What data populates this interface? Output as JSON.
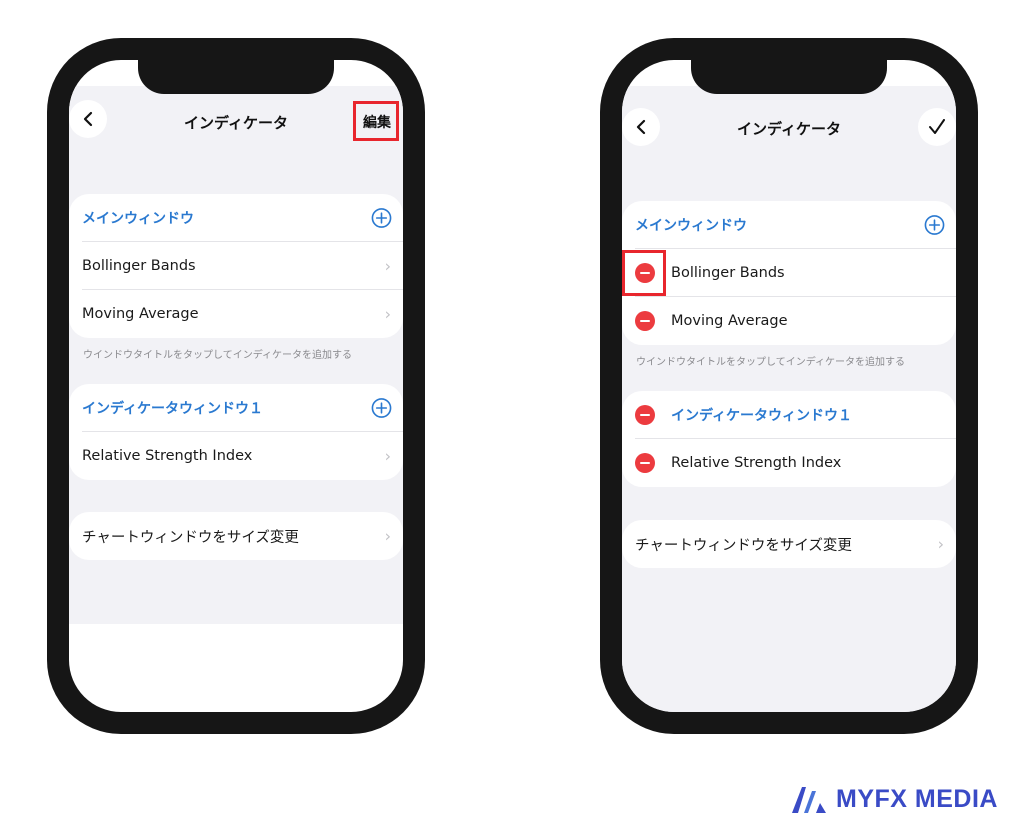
{
  "left": {
    "nav": {
      "title": "インディケータ",
      "edit_label": "編集"
    },
    "main_section": {
      "header": "メインウィンドウ",
      "items": [
        {
          "label": "Bollinger Bands"
        },
        {
          "label": "Moving Average"
        }
      ],
      "footer": "ウインドウタイトルをタップしてインディケータを追加する"
    },
    "indicator_section": {
      "header": "インディケータウィンドウ１",
      "items": [
        {
          "label": "Relative Strength Index"
        }
      ]
    },
    "resize_label": "チャートウィンドウをサイズ変更"
  },
  "right": {
    "nav": {
      "title": "インディケータ"
    },
    "main_section": {
      "header": "メインウィンドウ",
      "items": [
        {
          "label": "Bollinger Bands"
        },
        {
          "label": "Moving Average"
        }
      ],
      "footer": "ウインドウタイトルをタップしてインディケータを追加する"
    },
    "indicator_section": {
      "header": "インディケータウィンドウ１",
      "items": [
        {
          "label": "Relative Strength Index"
        }
      ]
    },
    "resize_label": "チャートウィンドウをサイズ変更"
  },
  "brand": {
    "name": "MYFX MEDIA"
  },
  "colors": {
    "accent": "#2a79d0",
    "delete": "#ec3b3f",
    "highlight": "#e8262d",
    "brand": "#3a4bc6"
  }
}
